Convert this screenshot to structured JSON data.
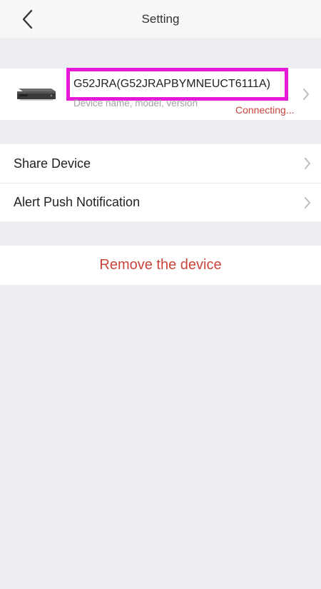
{
  "header": {
    "title": "Setting",
    "back_icon": "chevron-left-icon"
  },
  "device": {
    "name": "G52JRA(G52JRAPBYMNEUCT6111A)",
    "subtitle": "Device name, model, version",
    "status": "Connecting...",
    "image": "nvr-device-icon",
    "highlight_color": "#e619d9"
  },
  "menu": {
    "items": [
      {
        "label": "Share Device",
        "icon": "chevron-right-icon"
      },
      {
        "label": "Alert Push Notification",
        "icon": "chevron-right-icon"
      }
    ]
  },
  "remove": {
    "label": "Remove the device",
    "color": "#c9443a"
  }
}
